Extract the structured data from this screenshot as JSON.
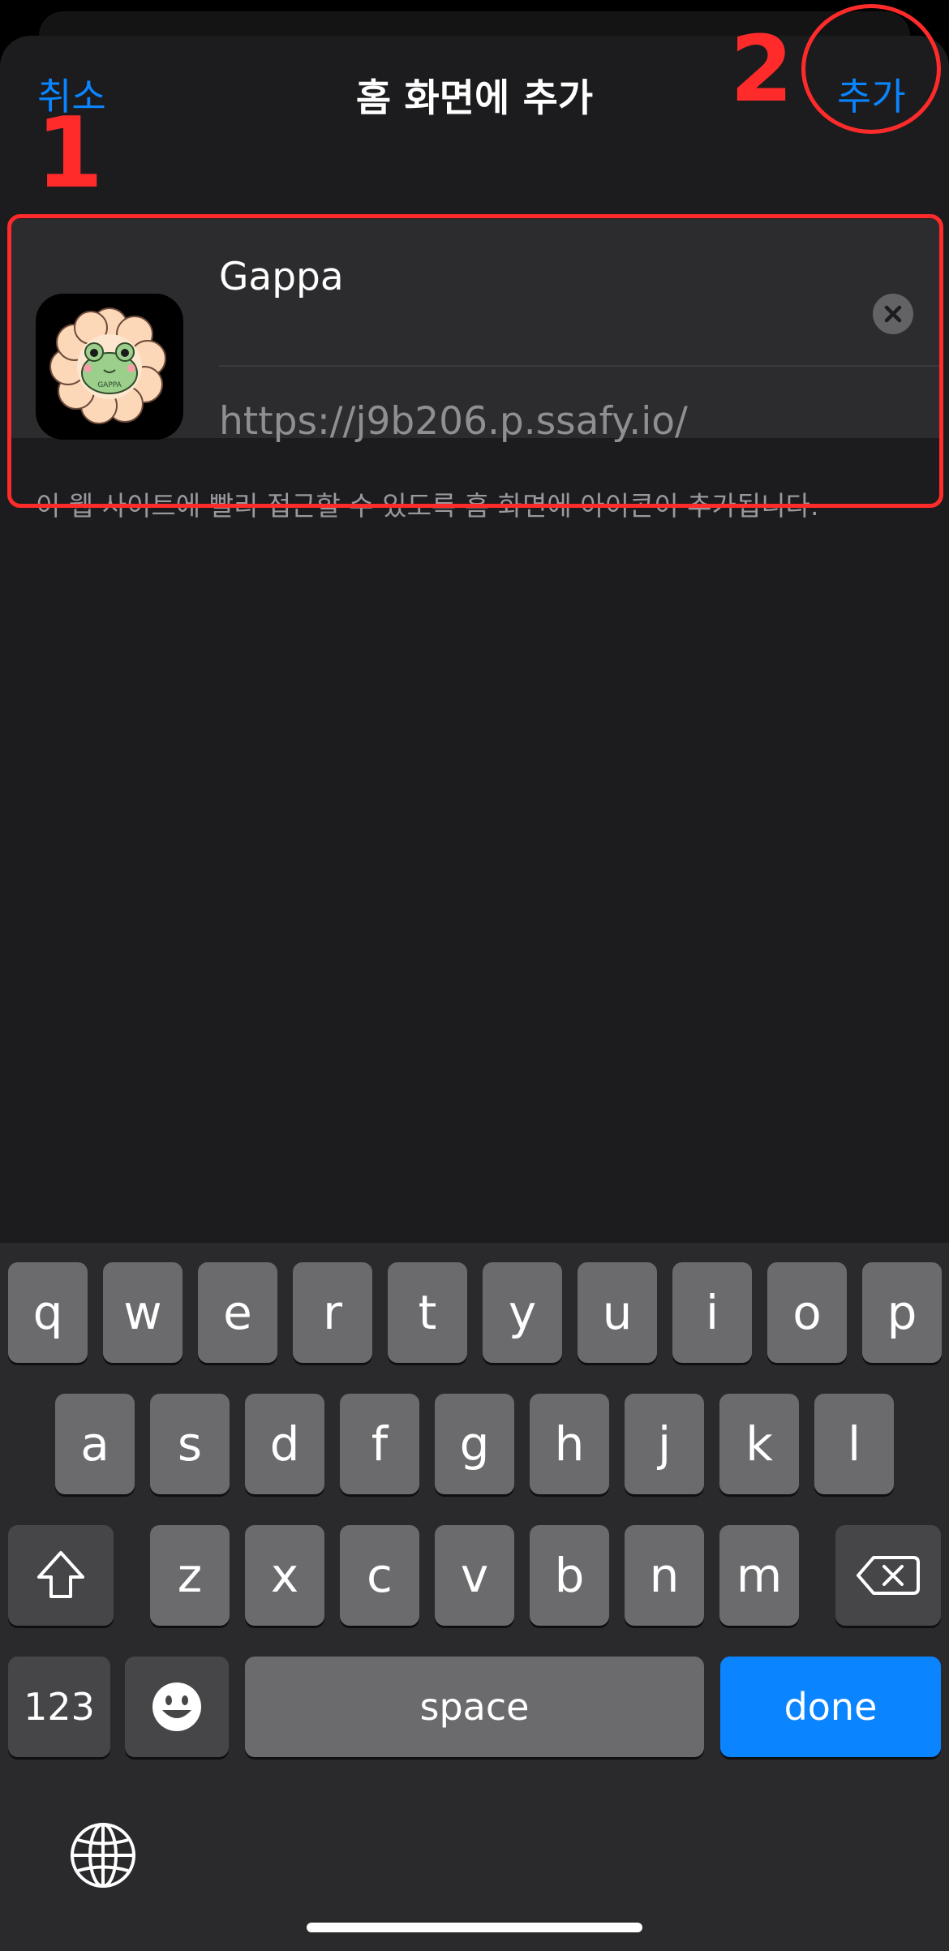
{
  "nav": {
    "cancel_label": "취소",
    "title": "홈 화면에 추가",
    "add_label": "추가"
  },
  "form": {
    "name_value": "Gappa",
    "url": "https://j9b206.p.ssafy.io/",
    "hint": "이 웹 사이트에 빨리 접근할 수 있도록 홈 화면에 아이콘이 추가됩니다.",
    "icon_text": "GAPPA"
  },
  "annotations": {
    "step1": "1",
    "step2": "2"
  },
  "keyboard": {
    "row1": [
      "q",
      "w",
      "e",
      "r",
      "t",
      "y",
      "u",
      "i",
      "o",
      "p"
    ],
    "row2": [
      "a",
      "s",
      "d",
      "f",
      "g",
      "h",
      "j",
      "k",
      "l"
    ],
    "row3": [
      "z",
      "x",
      "c",
      "v",
      "b",
      "n",
      "m"
    ],
    "numbers_label": "123",
    "space_label": "space",
    "done_label": "done"
  },
  "colors": {
    "accent": "#0a84ff",
    "annotation": "#ff2b2b",
    "sheet_bg": "#1c1c1e",
    "card_bg": "#2c2c2e",
    "key_bg": "#6b6b6e"
  },
  "icons": {
    "clear": "clear-circle-icon",
    "shift": "shift-icon",
    "delete": "delete-backspace-icon",
    "emoji": "emoji-icon",
    "globe": "globe-icon"
  }
}
